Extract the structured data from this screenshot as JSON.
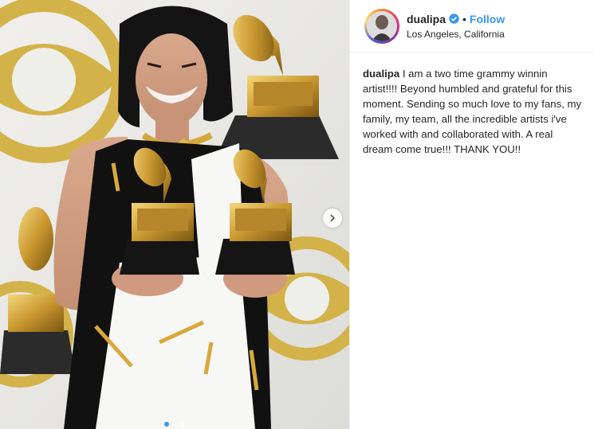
{
  "post": {
    "username": "dualipa",
    "separator": "•",
    "follow_label": "Follow",
    "location": "Los Angeles, California",
    "caption": {
      "username": "dualipa",
      "text": "I am a two time grammy winnin artist!!!! Beyond humbled and grateful for this moment. Sending so much love to my fans, my family, my team, all the incredible artists i've worked with and collaborated with. A real dream come true!!! THANK YOU!!"
    }
  },
  "carousel": {
    "slide_count": 3,
    "active_index": 0
  },
  "icons": {
    "verified": "verified-badge-icon",
    "next": "chevron-right-icon"
  },
  "colors": {
    "link_blue": "#3897f0",
    "cbs_gold": "#c9a53a",
    "text": "#262626"
  }
}
